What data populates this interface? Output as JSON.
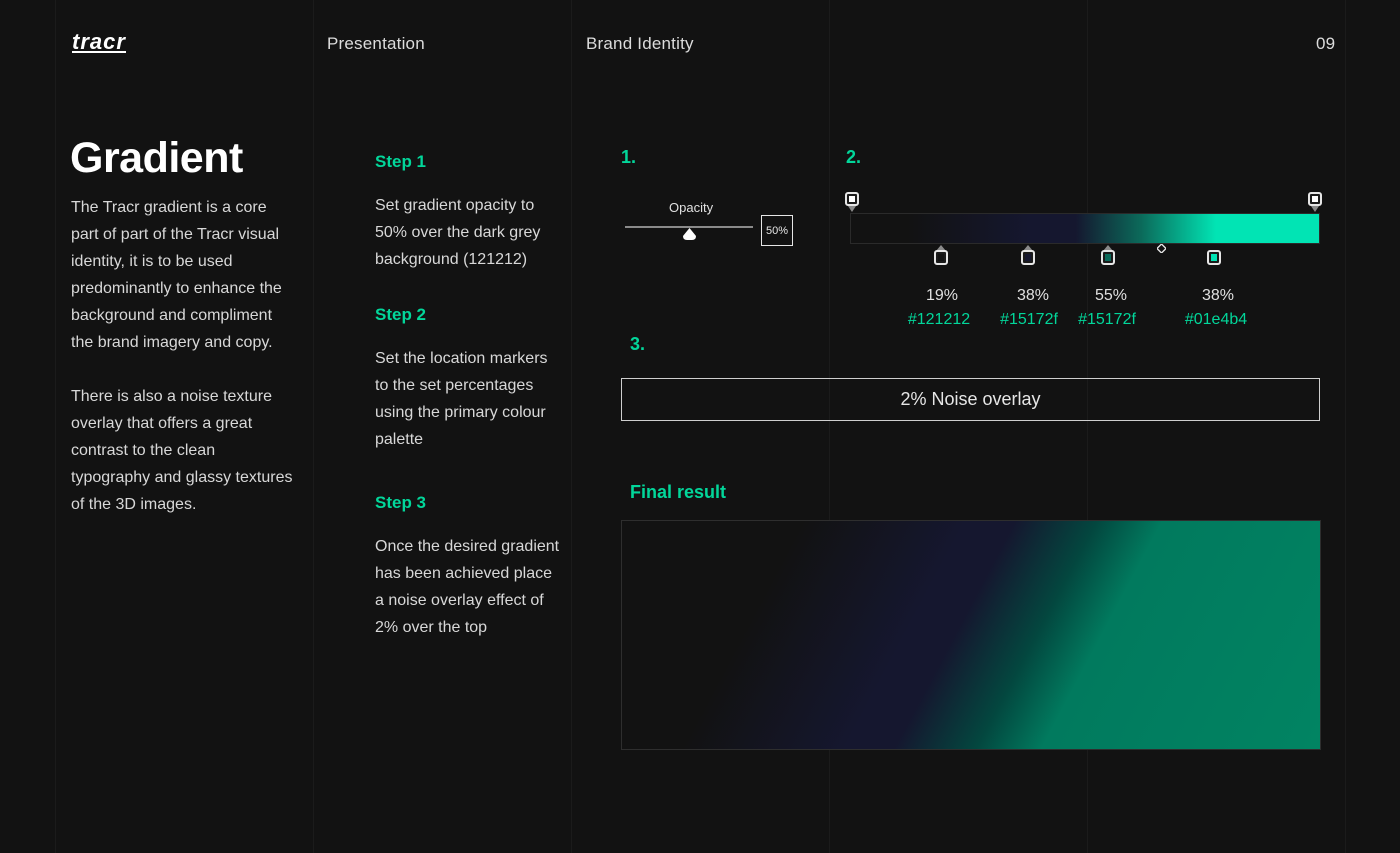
{
  "header": {
    "logo": "tracr",
    "section": "Presentation",
    "subsection": "Brand Identity",
    "page_number": "09"
  },
  "intro": {
    "title": "Gradient",
    "paragraph1": "The Tracr gradient is a core part of part of the Tracr visual identity, it is to be used predominantly to enhance the background and compliment the brand imagery and copy.",
    "paragraph2": "There is also a noise texture overlay that offers a great contrast to the clean typography and glassy textures of the 3D images."
  },
  "steps": [
    {
      "title": "Step 1",
      "body": "Set gradient opacity to 50% over the dark grey background (121212)"
    },
    {
      "title": "Step 2",
      "body": "Set the location markers to the set percentages using the primary colour palette"
    },
    {
      "title": "Step 3",
      "body": "Once the desired gradient has been achieved place a noise overlay effect of 2% over the top"
    }
  ],
  "panel1": {
    "number": "1.",
    "opacity_label": "Opacity",
    "opacity_value": "50%",
    "opacity_level": 0.5
  },
  "panel2": {
    "number": "2.",
    "stops": [
      {
        "percent": "19%",
        "hex": "#121212",
        "color": "#121212"
      },
      {
        "percent": "38%",
        "hex": "#15172f",
        "color": "#15172f"
      },
      {
        "percent": "55%",
        "hex": "#15172f",
        "color": "#15172f"
      },
      {
        "percent": "38%",
        "hex": "#01e4b4",
        "color": "#01e4b4"
      }
    ]
  },
  "panel3": {
    "number": "3.",
    "noise_label": "2% Noise overlay"
  },
  "final": {
    "label": "Final result"
  },
  "colors": {
    "background": "#121212",
    "accent": "#02d69a",
    "navy": "#15172f",
    "mint": "#01e4b4"
  }
}
